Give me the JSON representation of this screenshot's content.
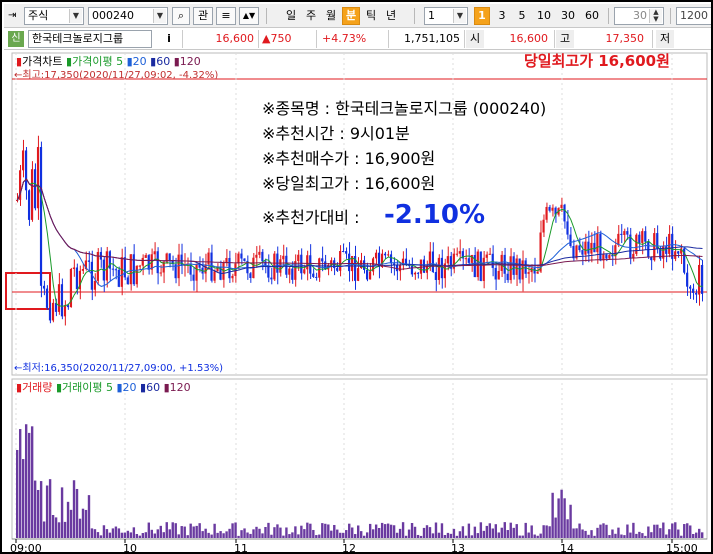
{
  "toolbar": {
    "market": "주식",
    "code": "000240",
    "search_icon": "search-icon",
    "gwan": "관",
    "periods": [
      "일",
      "주",
      "월",
      "분",
      "틱",
      "년"
    ],
    "active_period": "분",
    "interval_value": "1",
    "minute_buttons": [
      "1",
      "3",
      "5",
      "10",
      "30",
      "60"
    ],
    "active_minute": "1",
    "count_value": "30",
    "range_value": "1200"
  },
  "info": {
    "badge": "신",
    "name": "한국테크놀로지그룹",
    "i_label": "i",
    "price": "16,600",
    "change": "▲750",
    "change_pct": "+4.73%",
    "volume": "1,751,105",
    "si_label": "시",
    "open": "16,600",
    "go_label": "고",
    "high": "17,350",
    "jeo_label": "저"
  },
  "legends": {
    "price": [
      "가격차트",
      "가격이평",
      "5",
      "20",
      "60",
      "120"
    ],
    "volume": [
      "거래량",
      "거래이평",
      "5",
      "20",
      "60",
      "120"
    ]
  },
  "markers": {
    "high_note": "←최고:17,350(2020/11/27,09:02, -4.32%)",
    "low_note": "←최저:16,350(2020/11/27,09:00, +1.53%)",
    "top_right": "당일최고가 16,600원"
  },
  "annotation": {
    "line1": "※종목명 : 한국테크놀로지그룹 (000240)",
    "line2": "※추천시간 : 9시01분",
    "line3": "※추천매수가 : 16,900원",
    "line4": "※당일최고가 : 16,600원",
    "line5_label": "※추천가대비 :",
    "line5_value": "-2.10%"
  },
  "xaxis": {
    "labels": [
      "09:00",
      "10",
      "11",
      "12",
      "13",
      "14",
      "15:00"
    ]
  },
  "colors": {
    "up": "#e0191e",
    "down": "#1030e0",
    "ma5": "#1a9a2a",
    "ma20": "#1e60d8",
    "ma60": "#1a2aa0",
    "ma120": "#7a1a50",
    "volume": "#6a3aa0"
  }
}
